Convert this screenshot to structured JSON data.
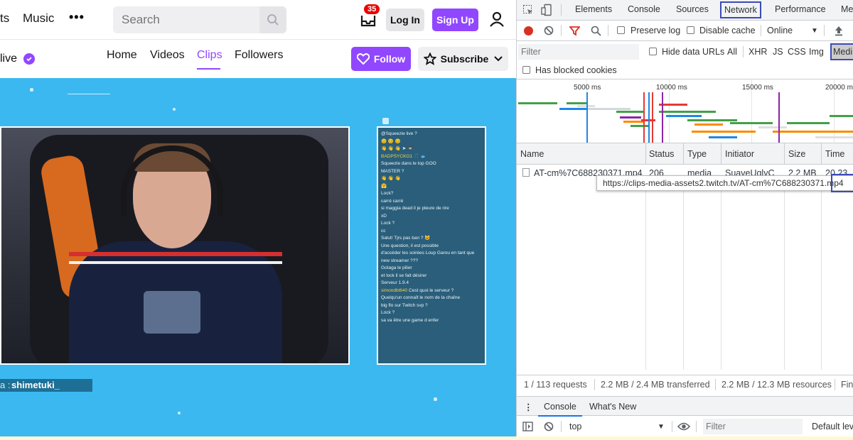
{
  "twitch": {
    "nav": {
      "partial_left": "ts",
      "music": "Music",
      "more": "•••",
      "search_placeholder": "Search",
      "notif_count": "35",
      "login": "Log In",
      "signup": "Sign Up"
    },
    "channel": {
      "live_partial": "live",
      "tabs": [
        "Home",
        "Videos",
        "Clips",
        "Followers"
      ],
      "active_tab": "Clips",
      "follow": "Follow",
      "subscribe": "Subscribe"
    },
    "video": {
      "overlay_prefix": "a :",
      "overlay_name": "shimetuki_"
    },
    "chat_lines": [
      {
        "user": "",
        "text": "@Squeezie live ?"
      },
      {
        "user": "",
        "text": "😊 😊 😊"
      },
      {
        "user": "",
        "text": "👋 👋 👋 ➤ 📼"
      },
      {
        "user": "BADPSYCKO1",
        "text": "🎵 🐟"
      },
      {
        "user": "",
        "text": "Squeezie dans le top GOO"
      },
      {
        "user": "",
        "text": "MASTER ?"
      },
      {
        "user": "",
        "text": "👋 👋 👋"
      },
      {
        "user": "",
        "text": "🤗"
      },
      {
        "user": "",
        "text": "Lock?"
      },
      {
        "user": "",
        "text": "carré carré"
      },
      {
        "user": "",
        "text": "si maggia dead il je pleure de rire"
      },
      {
        "user": "",
        "text": "xD"
      },
      {
        "user": "",
        "text": "Lock ?"
      },
      {
        "user": "",
        "text": "cc"
      },
      {
        "user": "",
        "text": "Salut! Tjrs pas ban ? 😺"
      },
      {
        "user": "",
        "text": "Une question, il est possible"
      },
      {
        "user": "",
        "text": "d'accéder les soirées Loup Garou en tant que"
      },
      {
        "user": "",
        "text": "new streamer ???"
      },
      {
        "user": "",
        "text": "Gotaga le pilier"
      },
      {
        "user": "",
        "text": "et lock il se fait désirer"
      },
      {
        "user": "",
        "text": "Serveur 1.9.4"
      },
      {
        "user": "simondbt640",
        "text": "Cest quoi le serveur ?"
      },
      {
        "user": "",
        "text": "Quelqu'un connaît le nom de la chaîne"
      },
      {
        "user": "",
        "text": "big flo sur Twitch svp ?"
      },
      {
        "user": "",
        "text": "Lock ?"
      },
      {
        "user": "",
        "text": "sa va être une game d enfer"
      }
    ]
  },
  "devtools": {
    "tabs": [
      "Elements",
      "Console",
      "Sources",
      "Network",
      "Performance",
      "Me"
    ],
    "active_tab": "Network",
    "toolbar": {
      "preserve_log": "Preserve log",
      "disable_cache": "Disable cache",
      "throttle": "Online"
    },
    "filter": {
      "placeholder": "Filter",
      "hide_data_urls": "Hide data URLs",
      "types": [
        "All",
        "XHR",
        "JS",
        "CSS",
        "Img",
        "Medi"
      ],
      "active_type": "Medi"
    },
    "has_blocked_cookies": "Has blocked cookies",
    "timeline_labels": [
      "5000 ms",
      "10000 ms",
      "15000 ms",
      "20000 m"
    ],
    "columns": [
      "Name",
      "Status",
      "Type",
      "Initiator",
      "Size",
      "Time"
    ],
    "rows": [
      {
        "name": "AT-cm%7C688230371.mp4",
        "status": "206",
        "type": "media",
        "initiator": "SuaveUglyC",
        "size": "2.2 MB",
        "time": "20.23"
      }
    ],
    "tooltip": "https://clips-media-assets2.twitch.tv/AT-cm%7C688230371.mp4",
    "tooltip_highlight": "mp4",
    "status": {
      "requests": "1 / 113 requests",
      "transferred": "2.2 MB / 2.4 MB transferred",
      "resources": "2.2 MB / 12.3 MB resources",
      "finish": "Fin"
    },
    "drawer_tabs": [
      "Console",
      "What's New"
    ],
    "console": {
      "context": "top",
      "filter_placeholder": "Filter",
      "levels": "Default lev"
    }
  },
  "colors": {
    "twitch_purple": "#9147ff",
    "video_bg": "#3bb8f0",
    "highlight_border": "#3c4ab8"
  }
}
